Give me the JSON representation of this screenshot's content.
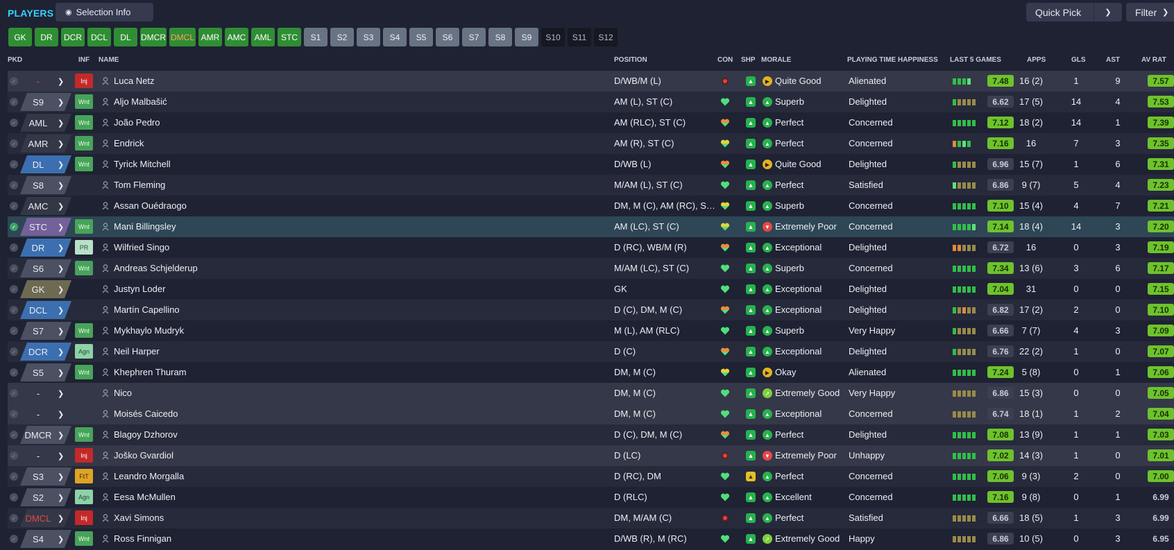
{
  "header": {
    "title": "PLAYERS",
    "selection_info": "Selection Info",
    "quick_pick": "Quick Pick",
    "filter": "Filter"
  },
  "pills": [
    {
      "label": "GK",
      "style": "green"
    },
    {
      "label": "DR",
      "style": "green"
    },
    {
      "label": "DCR",
      "style": "green"
    },
    {
      "label": "DCL",
      "style": "green"
    },
    {
      "label": "DL",
      "style": "green"
    },
    {
      "label": "DMCR",
      "style": "green"
    },
    {
      "label": "DMCL",
      "style": "green warn"
    },
    {
      "label": "AMR",
      "style": "green"
    },
    {
      "label": "AMC",
      "style": "green"
    },
    {
      "label": "AML",
      "style": "green"
    },
    {
      "label": "STC",
      "style": "green"
    },
    {
      "label": "S1",
      "style": "grey"
    },
    {
      "label": "S2",
      "style": "grey"
    },
    {
      "label": "S3",
      "style": "grey"
    },
    {
      "label": "S4",
      "style": "grey"
    },
    {
      "label": "S5",
      "style": "grey"
    },
    {
      "label": "S6",
      "style": "grey"
    },
    {
      "label": "S7",
      "style": "grey"
    },
    {
      "label": "S8",
      "style": "grey"
    },
    {
      "label": "S9",
      "style": "grey"
    },
    {
      "label": "S10",
      "style": "dark"
    },
    {
      "label": "S11",
      "style": "dark"
    },
    {
      "label": "S12",
      "style": "dark"
    }
  ],
  "columns": {
    "pkd": "PKD",
    "inf": "INF",
    "name": "NAME",
    "position": "POSITION",
    "con": "CON",
    "shp": "SHP",
    "morale": "MORALE",
    "pth": "PLAYING TIME HAPPINESS",
    "l5": "LAST 5 GAMES",
    "apps": "APPS",
    "gls": "GLS",
    "ast": "AST",
    "avrat": "AV RAT"
  },
  "players": [
    {
      "pkd": "-",
      "pkd_color": "none",
      "pkd_red": true,
      "inf": "Inj",
      "name": "Luca Netz",
      "position": "D/WB/M (L)",
      "con": "injured",
      "shp": "green",
      "morale_icon": "mid",
      "morale": "Quite Good",
      "pth": "Alienated",
      "l5": "ggglg",
      "l5avg": "7.48",
      "l5hi": true,
      "apps": "16 (2)",
      "gls": "1",
      "ast": "9",
      "avrat": "7.57",
      "avhi": true,
      "bg": "unsel"
    },
    {
      "pkd": "S9",
      "pkd_color": "c-grey",
      "inf": "Wnt",
      "name": "Aljo Malbašić",
      "position": "AM (L), ST (C)",
      "con": "heart",
      "shp": "green",
      "morale_icon": "up",
      "morale": "Superb",
      "pth": "Delighted",
      "l5": "gbbbb",
      "l5avg": "6.62",
      "l5hi": false,
      "apps": "17 (5)",
      "gls": "14",
      "ast": "4",
      "avrat": "7.53",
      "avhi": true,
      "bg": "odd"
    },
    {
      "pkd": "AML",
      "pkd_color": "c-dark",
      "inf": "Wnt",
      "name": "João Pedro",
      "position": "AM (RLC), ST (C)",
      "con": "heart-o",
      "shp": "green",
      "morale_icon": "up",
      "morale": "Perfect",
      "pth": "Concerned",
      "l5": "ggggg",
      "l5avg": "7.12",
      "l5hi": true,
      "apps": "18 (2)",
      "gls": "14",
      "ast": "1",
      "avrat": "7.39",
      "avhi": true,
      "bg": "even"
    },
    {
      "pkd": "AMR",
      "pkd_color": "c-dark",
      "inf": "Wnt",
      "name": "Endrick",
      "position": "AM (R), ST (C)",
      "con": "heart-y",
      "shp": "green",
      "morale_icon": "up",
      "morale": "Perfect",
      "pth": "Concerned",
      "l5": "oglgg",
      "l5avg": "7.16",
      "l5hi": true,
      "apps": "16",
      "gls": "7",
      "ast": "3",
      "avrat": "7.35",
      "avhi": true,
      "bg": "odd"
    },
    {
      "pkd": "DL",
      "pkd_color": "c-blue",
      "inf": "Wnt",
      "name": "Tyrick Mitchell",
      "position": "D/WB (L)",
      "con": "heart-o",
      "shp": "green",
      "morale_icon": "mid",
      "morale": "Quite Good",
      "pth": "Delighted",
      "l5": "gbbbb",
      "l5avg": "6.96",
      "l5hi": false,
      "apps": "15 (7)",
      "gls": "1",
      "ast": "6",
      "avrat": "7.31",
      "avhi": true,
      "bg": "even"
    },
    {
      "pkd": "S8",
      "pkd_color": "c-grey",
      "inf": "",
      "name": "Tom Fleming",
      "position": "M/AM (L), ST (C)",
      "con": "heart",
      "shp": "green",
      "morale_icon": "up",
      "morale": "Perfect",
      "pth": "Satisfied",
      "l5": "lgbbbb",
      "l5avg": "6.86",
      "l5hi": false,
      "apps": "9 (7)",
      "gls": "5",
      "ast": "4",
      "avrat": "7.23",
      "avhi": true,
      "bg": "odd"
    },
    {
      "pkd": "AMC",
      "pkd_color": "c-dark",
      "inf": "",
      "name": "Assan Ouédraogo",
      "position": "DM, M (C), AM (RC), ST (C)",
      "con": "heart-y",
      "shp": "green",
      "morale_icon": "up",
      "morale": "Superb",
      "pth": "Concerned",
      "l5": "ggggg",
      "l5avg": "7.10",
      "l5hi": true,
      "apps": "15 (4)",
      "gls": "4",
      "ast": "7",
      "avrat": "7.21",
      "avhi": true,
      "bg": "even"
    },
    {
      "pkd": "STC",
      "pkd_color": "c-purple",
      "inf": "Wnt",
      "name": "Mani Billingsley",
      "position": "AM (LC), ST (C)",
      "con": "heart-y",
      "shp": "green",
      "morale_icon": "down",
      "morale": "Extremely Poor",
      "pth": "Concerned",
      "l5": "gggglg",
      "l5avg": "7.14",
      "l5hi": true,
      "apps": "18 (4)",
      "gls": "14",
      "ast": "3",
      "avrat": "7.20",
      "avhi": true,
      "bg": "hl",
      "checked": true
    },
    {
      "pkd": "DR",
      "pkd_color": "c-blue",
      "inf": "PR",
      "name": "Wilfried Singo",
      "position": "D (RC), WB/M (R)",
      "con": "heart-o",
      "shp": "green",
      "morale_icon": "up",
      "morale": "Exceptional",
      "pth": "Delighted",
      "l5": "oobbb",
      "l5avg": "6.72",
      "l5hi": false,
      "apps": "16",
      "gls": "0",
      "ast": "3",
      "avrat": "7.19",
      "avhi": true,
      "bg": "even"
    },
    {
      "pkd": "S6",
      "pkd_color": "c-grey",
      "inf": "Wnt",
      "name": "Andreas Schjelderup",
      "position": "M/AM (LC), ST (C)",
      "con": "heart",
      "shp": "green",
      "morale_icon": "up",
      "morale": "Superb",
      "pth": "Concerned",
      "l5": "ggggg",
      "l5avg": "7.34",
      "l5hi": true,
      "apps": "13 (6)",
      "gls": "3",
      "ast": "6",
      "avrat": "7.17",
      "avhi": true,
      "bg": "odd"
    },
    {
      "pkd": "GK",
      "pkd_color": "c-olive",
      "inf": "",
      "name": "Justyn Loder",
      "position": "GK",
      "con": "heart",
      "shp": "green",
      "morale_icon": "up",
      "morale": "Exceptional",
      "pth": "Delighted",
      "l5": "ggggg",
      "l5avg": "7.04",
      "l5hi": true,
      "apps": "31",
      "gls": "0",
      "ast": "0",
      "avrat": "7.15",
      "avhi": true,
      "bg": "even"
    },
    {
      "pkd": "DCL",
      "pkd_color": "c-blue",
      "inf": "",
      "name": "Martín Capellino",
      "position": "D (C), DM, M (C)",
      "con": "heart-o",
      "shp": "green",
      "morale_icon": "up",
      "morale": "Exceptional",
      "pth": "Delighted",
      "l5": "gbobb",
      "l5avg": "6.82",
      "l5hi": false,
      "apps": "17 (2)",
      "gls": "2",
      "ast": "0",
      "avrat": "7.10",
      "avhi": true,
      "bg": "odd"
    },
    {
      "pkd": "S7",
      "pkd_color": "c-grey",
      "inf": "Wnt",
      "name": "Mykhaylo Mudryk",
      "position": "M (L), AM (RLC)",
      "con": "heart",
      "shp": "green",
      "morale_icon": "up",
      "morale": "Superb",
      "pth": "Very Happy",
      "l5": "gbbbb",
      "l5avg": "6.66",
      "l5hi": false,
      "apps": "7 (7)",
      "gls": "4",
      "ast": "3",
      "avrat": "7.09",
      "avhi": true,
      "bg": "even"
    },
    {
      "pkd": "DCR",
      "pkd_color": "c-blue",
      "inf": "Agn",
      "name": "Neil Harper",
      "position": "D (C)",
      "con": "heart-o",
      "shp": "green",
      "morale_icon": "up",
      "morale": "Exceptional",
      "pth": "Delighted",
      "l5": "gbbbb",
      "l5avg": "6.76",
      "l5hi": false,
      "apps": "22 (2)",
      "gls": "1",
      "ast": "0",
      "avrat": "7.07",
      "avhi": true,
      "bg": "odd"
    },
    {
      "pkd": "S5",
      "pkd_color": "c-grey",
      "inf": "Wnt",
      "name": "Khephren Thuram",
      "position": "DM, M (C)",
      "con": "heart-y",
      "shp": "green",
      "morale_icon": "mid",
      "morale": "Okay",
      "pth": "Alienated",
      "l5": "ggggg",
      "l5avg": "7.24",
      "l5hi": true,
      "apps": "5 (8)",
      "gls": "0",
      "ast": "1",
      "avrat": "7.06",
      "avhi": true,
      "bg": "even"
    },
    {
      "pkd": "-",
      "pkd_color": "none",
      "inf": "",
      "name": "Nico",
      "position": "DM, M (C)",
      "con": "heart",
      "shp": "green",
      "morale_icon": "up2",
      "morale": "Extremely Good",
      "pth": "Very Happy",
      "l5": "bbbbb",
      "l5avg": "6.86",
      "l5hi": false,
      "apps": "15 (3)",
      "gls": "0",
      "ast": "0",
      "avrat": "7.05",
      "avhi": true,
      "bg": "unsel"
    },
    {
      "pkd": "-",
      "pkd_color": "none",
      "inf": "",
      "name": "Moisés Caicedo",
      "position": "DM, M (C)",
      "con": "heart",
      "shp": "green",
      "morale_icon": "up",
      "morale": "Exceptional",
      "pth": "Concerned",
      "l5": "bbbbb",
      "l5avg": "6.74",
      "l5hi": false,
      "apps": "18 (1)",
      "gls": "1",
      "ast": "2",
      "avrat": "7.04",
      "avhi": true,
      "bg": "unsel"
    },
    {
      "pkd": "DMCR",
      "pkd_color": "c-grey",
      "inf": "Wnt",
      "name": "Blagoy Dzhorov",
      "position": "D (C), DM, M (C)",
      "con": "heart-o",
      "shp": "green",
      "morale_icon": "up",
      "morale": "Perfect",
      "pth": "Delighted",
      "l5": "ggggg",
      "l5avg": "7.08",
      "l5hi": true,
      "apps": "13 (9)",
      "gls": "1",
      "ast": "1",
      "avrat": "7.03",
      "avhi": true,
      "bg": "odd"
    },
    {
      "pkd": "-",
      "pkd_color": "none",
      "inf": "Inj",
      "name": "Joško Gvardiol",
      "position": "D (LC)",
      "con": "injured",
      "shp": "green",
      "morale_icon": "down",
      "morale": "Extremely Poor",
      "pth": "Unhappy",
      "l5": "ggggg",
      "l5avg": "7.02",
      "l5hi": true,
      "apps": "14 (3)",
      "gls": "1",
      "ast": "0",
      "avrat": "7.01",
      "avhi": true,
      "bg": "unsel"
    },
    {
      "pkd": "S3",
      "pkd_color": "c-grey",
      "inf": "FtT",
      "name": "Leandro Morgalla",
      "position": "D (RC), DM",
      "con": "heart",
      "shp": "yellow",
      "morale_icon": "up",
      "morale": "Perfect",
      "pth": "Concerned",
      "l5": "ggggg",
      "l5avg": "7.06",
      "l5hi": true,
      "apps": "9 (3)",
      "gls": "2",
      "ast": "0",
      "avrat": "7.00",
      "avhi": true,
      "bg": "odd"
    },
    {
      "pkd": "S2",
      "pkd_color": "c-grey",
      "inf": "Agn",
      "name": "Eesa McMullen",
      "position": "D (RLC)",
      "con": "heart",
      "shp": "green",
      "morale_icon": "up",
      "morale": "Excellent",
      "pth": "Concerned",
      "l5": "ggggg",
      "l5avg": "7.16",
      "l5hi": true,
      "apps": "9 (8)",
      "gls": "0",
      "ast": "1",
      "avrat": "6.99",
      "avhi": false,
      "bg": "even"
    },
    {
      "pkd": "DMCL",
      "pkd_color": "c-dark",
      "pkd_red": true,
      "inf": "Inj",
      "name": "Xavi Simons",
      "position": "DM, M/AM (C)",
      "con": "injured",
      "shp": "green",
      "morale_icon": "up",
      "morale": "Perfect",
      "pth": "Satisfied",
      "l5": "bbbbb",
      "l5avg": "6.66",
      "l5hi": false,
      "apps": "18 (5)",
      "gls": "1",
      "ast": "3",
      "avrat": "6.99",
      "avhi": false,
      "bg": "odd"
    },
    {
      "pkd": "S4",
      "pkd_color": "c-grey",
      "inf": "Wnt",
      "name": "Ross Finnigan",
      "position": "D/WB (R), M (RC)",
      "con": "heart",
      "shp": "green",
      "morale_icon": "up2",
      "morale": "Extremely Good",
      "pth": "Happy",
      "l5": "bbbbb",
      "l5avg": "6.86",
      "l5hi": false,
      "apps": "10 (5)",
      "gls": "0",
      "ast": "3",
      "avrat": "6.95",
      "avhi": false,
      "bg": "even"
    }
  ],
  "colors": {
    "accent": "#35d2ff",
    "pill_green": "#2f8e33",
    "pill_grey": "#687384",
    "rating_green": "#6ec22d",
    "injury_red": "#c42929"
  }
}
